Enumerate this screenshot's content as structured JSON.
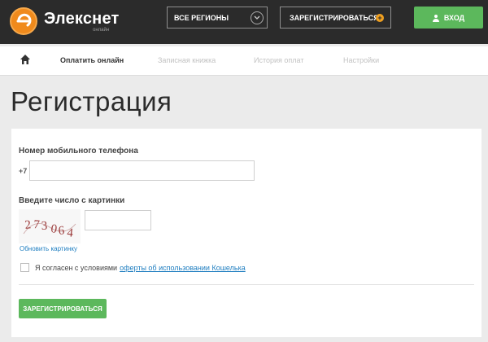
{
  "header": {
    "logo_title": "Элекснет",
    "logo_sub": "онлайн",
    "region_label": "ВСЕ РЕГИОНЫ",
    "register_label": "ЗАРЕГИСТРИРОВАТЬСЯ",
    "login_label": "ВХОД"
  },
  "nav": {
    "items": [
      {
        "label": "Оплатить онлайн",
        "active": true
      },
      {
        "label": "Записная книжка",
        "active": false
      },
      {
        "label": "История оплат",
        "active": false
      },
      {
        "label": "Настройки",
        "active": false
      }
    ]
  },
  "page": {
    "title": "Регистрация"
  },
  "form": {
    "phone_label": "Номер мобильного телефона",
    "phone_prefix": "+7",
    "phone_value": "",
    "captcha_label": "Введите число с картинки",
    "captcha_text": "273064",
    "captcha_value": "",
    "refresh_label": "Обновить картинку",
    "agree_text": "Я согласен с условиями",
    "agree_link": "оферты об использовании Кошелька",
    "submit_label": "ЗАРЕГИСТРИРОВАТЬСЯ"
  },
  "colors": {
    "header_bg": "#2b2b2b",
    "accent_orange": "#f08a1c",
    "accent_green": "#5cb85c",
    "link_blue": "#1f7ec0"
  }
}
